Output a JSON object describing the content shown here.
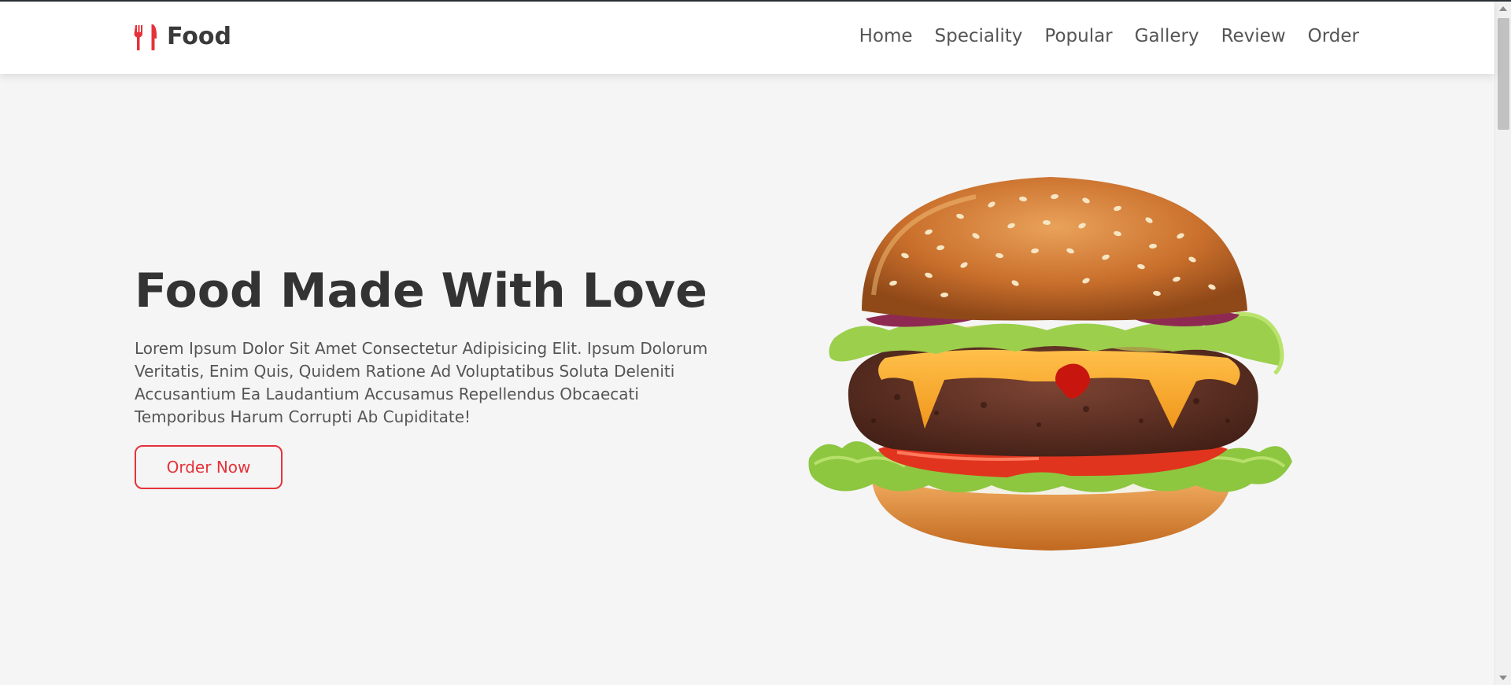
{
  "header": {
    "logo_text": "Food",
    "logo_icon": "utensils-icon",
    "nav": [
      {
        "label": "Home"
      },
      {
        "label": "Speciality"
      },
      {
        "label": "Popular"
      },
      {
        "label": "Gallery"
      },
      {
        "label": "Review"
      },
      {
        "label": "Order"
      }
    ]
  },
  "hero": {
    "title": "Food Made With Love",
    "description": "Lorem Ipsum Dolor Sit Amet Consectetur Adipisicing Elit. Ipsum Dolorum Veritatis, Enim Quis, Quidem Ratione Ad Voluptatibus Soluta Deleniti Accusantium Ea Laudantium Accusamus Repellendus Obcaecati Temporibus Harum Corrupti Ab Cupiditate!",
    "button_label": "Order Now",
    "image": "burger-image"
  },
  "colors": {
    "accent": "#e5323a",
    "background": "#f5f5f5",
    "header": "#ffffff",
    "text_dark": "#333333",
    "text_muted": "#555555"
  }
}
